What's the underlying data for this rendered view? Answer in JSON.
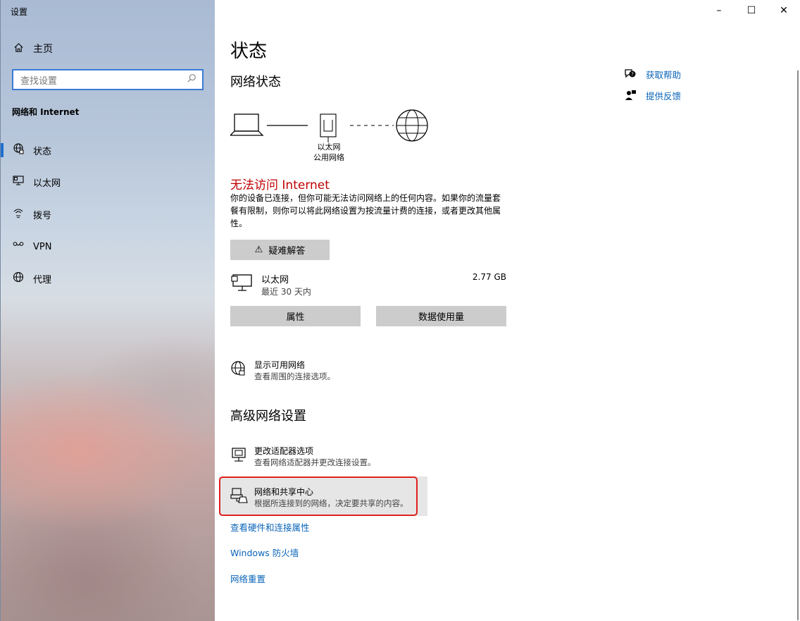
{
  "window": {
    "title": "设置",
    "minimize": "–",
    "maximize": "☐",
    "close": "✕"
  },
  "sidebar": {
    "home_label": "主页",
    "search_placeholder": "查找设置",
    "section_title": "网络和 Internet",
    "items": [
      {
        "label": "状态",
        "icon": "globe-status-icon",
        "active": true
      },
      {
        "label": "以太网",
        "icon": "ethernet-icon",
        "active": false
      },
      {
        "label": "拨号",
        "icon": "dialup-icon",
        "active": false
      },
      {
        "label": "VPN",
        "icon": "vpn-icon",
        "active": false
      },
      {
        "label": "代理",
        "icon": "globe-icon",
        "active": false
      }
    ]
  },
  "main": {
    "page_title": "状态",
    "network_status_heading": "网络状态",
    "diagram": {
      "adapter_name": "以太网",
      "network_type": "公用网络"
    },
    "error_title": "无法访问 Internet",
    "error_desc": "你的设备已连接，但你可能无法访问网络上的任何内容。如果你的流量套餐有限制，则你可以将此网络设置为按流量计费的连接，或者更改其他属性。",
    "troubleshoot_label": "疑难解答",
    "ethernet": {
      "name": "以太网",
      "period": "最近 30 天内",
      "usage": "2.77 GB"
    },
    "properties_label": "属性",
    "data_usage_label": "数据使用量",
    "show_networks": {
      "title": "显示可用网络",
      "desc": "查看周围的连接选项。"
    },
    "advanced_heading": "高级网络设置",
    "adapter_options": {
      "title": "更改适配器选项",
      "desc": "查看网络适配器并更改连接设置。"
    },
    "sharing_center": {
      "title": "网络和共享中心",
      "desc": "根据所连接到的网络，决定要共享的内容。"
    },
    "links": [
      "查看硬件和连接属性",
      "Windows 防火墙",
      "网络重置"
    ]
  },
  "help": {
    "get_help": "获取帮助",
    "feedback": "提供反馈"
  },
  "colors": {
    "accent": "#1e6fd0",
    "error": "#c00000",
    "link": "#0a64b8",
    "highlight_border": "#e02020"
  }
}
